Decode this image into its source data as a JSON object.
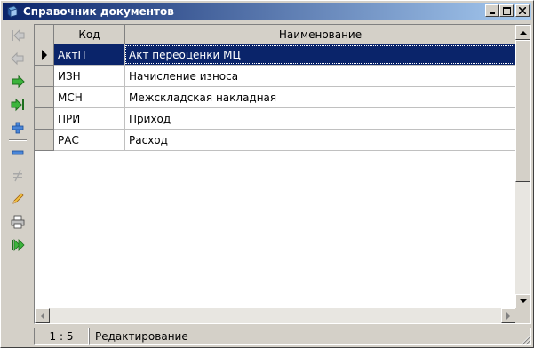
{
  "window": {
    "title": "Справочник документов",
    "icon": "book-icon",
    "buttons": [
      "minimize-icon",
      "maximize-icon",
      "close-icon"
    ]
  },
  "toolbar": {
    "items": [
      {
        "name": "first-record-button",
        "icon": "arrow-first-icon",
        "enabled": false
      },
      {
        "name": "previous-record-button",
        "icon": "arrow-left-icon",
        "enabled": false
      },
      {
        "name": "next-record-button",
        "icon": "arrow-right-icon",
        "enabled": true
      },
      {
        "name": "last-record-button",
        "icon": "arrow-last-icon",
        "enabled": true
      },
      {
        "name": "add-record-button",
        "icon": "plus-icon",
        "enabled": true
      },
      {
        "name": "delete-record-button",
        "icon": "minus-icon",
        "enabled": true
      },
      {
        "name": "cancel-edit-button",
        "icon": "not-equal-icon",
        "enabled": false
      },
      {
        "name": "edit-record-button",
        "icon": "pencil-icon",
        "enabled": true
      },
      {
        "name": "print-button",
        "icon": "printer-icon",
        "enabled": true
      },
      {
        "name": "run-button",
        "icon": "play-double-icon",
        "enabled": true
      }
    ]
  },
  "grid": {
    "columns": [
      "Код",
      "Наименование"
    ],
    "rows": [
      {
        "code": "АктП",
        "name": "Акт переоценки МЦ",
        "selected": true
      },
      {
        "code": "ИЗН",
        "name": "Начисление износа",
        "selected": false
      },
      {
        "code": "МСН",
        "name": "Межскладская накладная",
        "selected": false
      },
      {
        "code": "ПРИ",
        "name": "Приход",
        "selected": false
      },
      {
        "code": "РАС",
        "name": "Расход",
        "selected": false
      }
    ]
  },
  "status": {
    "position": "1 : 5",
    "mode": "Редактирование"
  },
  "colors": {
    "selection": "#0a246a",
    "face": "#d4d0c8",
    "arrow_green": "#3cb43c"
  }
}
